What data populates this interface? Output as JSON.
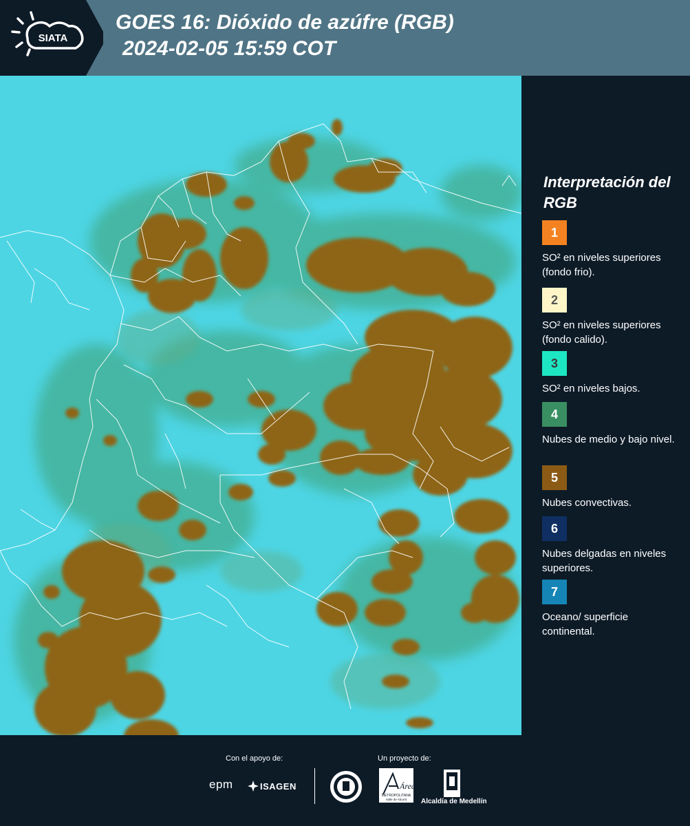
{
  "header": {
    "logo_text": "SIATA",
    "title_line1": "GOES 16: Dióxido de azúfre (RGB)",
    "title_line2": "2024-02-05 15:59 COT"
  },
  "legend": {
    "title": "Interpretación del RGB",
    "items": [
      {
        "number": "1",
        "color": "#f58220",
        "num_color": "#ffffff",
        "text": "SO² en niveles superiores (fondo frio)."
      },
      {
        "number": "2",
        "color": "#fff6c8",
        "num_color": "#555555",
        "text": "SO² en niveles superiores (fondo calido)."
      },
      {
        "number": "3",
        "color": "#1de7c3",
        "num_color": "#3a3a3a",
        "text": "SO² en niveles bajos."
      },
      {
        "number": "4",
        "color": "#3a8f62",
        "num_color": "#ffffff",
        "text": "Nubes de medio y bajo nivel."
      },
      {
        "number": "5",
        "color": "#8b5b15",
        "num_color": "#ffffff",
        "text": "Nubes convectivas."
      },
      {
        "number": "6",
        "color": "#0f2f63",
        "num_color": "#ffffff",
        "text": "Nubes delgadas en niveles superiores."
      },
      {
        "number": "7",
        "color": "#1585b5",
        "num_color": "#ffffff",
        "text": "Oceano/ superficie continental."
      }
    ]
  },
  "footer": {
    "support_label": "Con el apoyo de:",
    "project_label": "Un proyecto de:",
    "epm": "epm",
    "isagen": "ISAGEN",
    "area_name": "Área",
    "area_sub1": "METROPOLITANA",
    "area_sub2": "Valle de Aburrá",
    "alcaldia": "Alcaldía de Medellín"
  }
}
